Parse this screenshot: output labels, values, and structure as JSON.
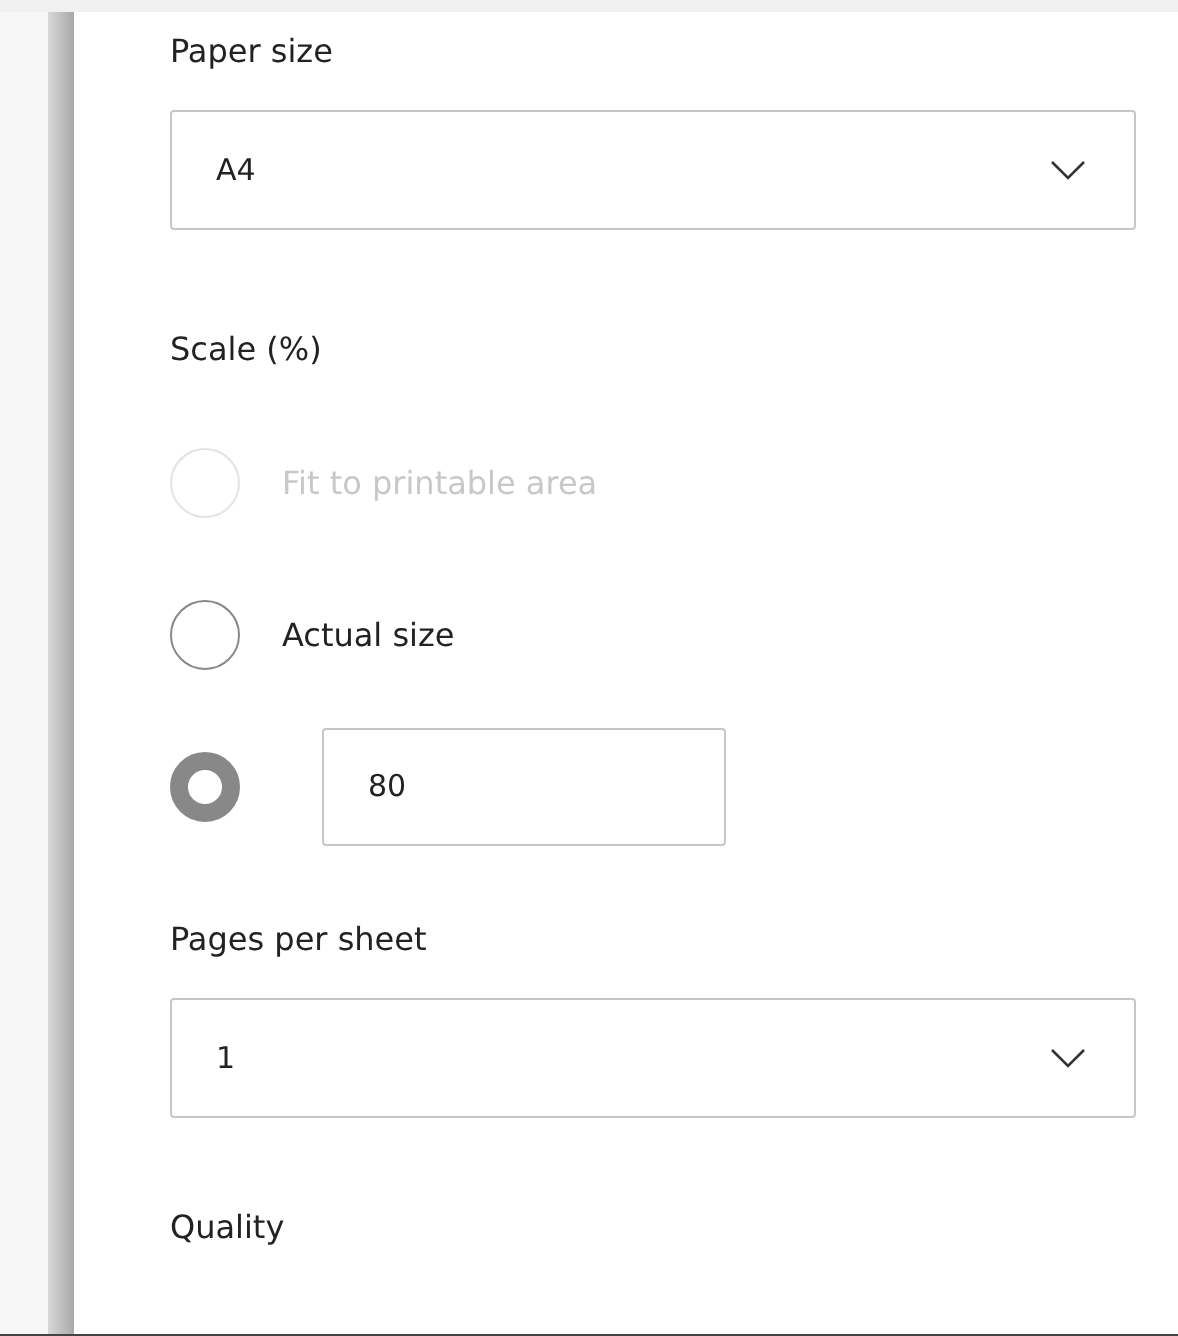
{
  "paper_size": {
    "label": "Paper size",
    "value": "A4"
  },
  "scale": {
    "label": "Scale (%)",
    "options": [
      {
        "kind": "plain",
        "label": "Fit to printable area",
        "selected": false,
        "disabled": true
      },
      {
        "kind": "plain",
        "label": "Actual size",
        "selected": false,
        "disabled": false
      },
      {
        "kind": "custom",
        "value": "80",
        "selected": true,
        "disabled": false
      }
    ]
  },
  "pages_per_sheet": {
    "label": "Pages per sheet",
    "value": "1"
  },
  "quality": {
    "label": "Quality"
  }
}
